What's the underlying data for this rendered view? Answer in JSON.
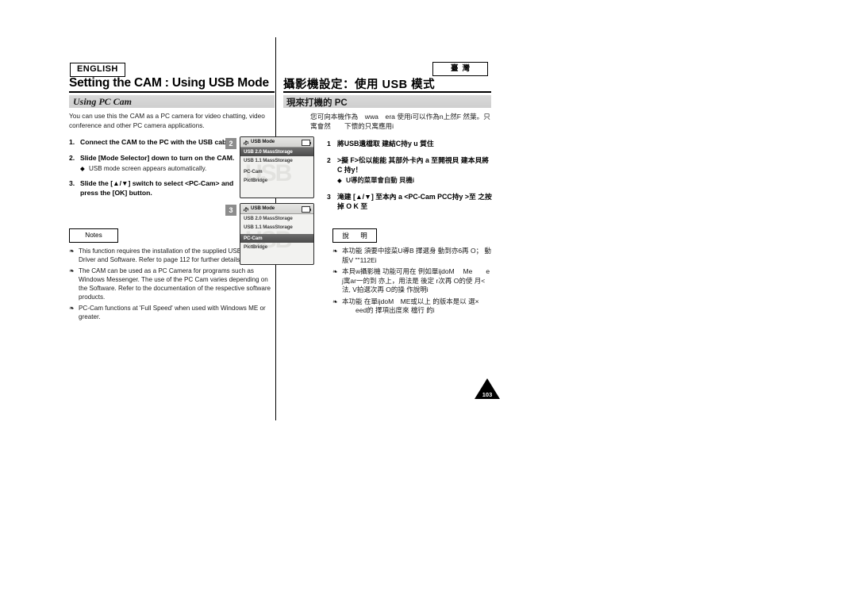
{
  "document": {
    "page_number": "103"
  },
  "left": {
    "language_badge": "ENGLISH",
    "title": "Setting the CAM : Using USB Mode",
    "section_title": "Using PC Cam",
    "intro": "You can use this the CAM as a PC camera for video chatting, video conference and other PC camera applications.",
    "steps": [
      {
        "num": "1.",
        "text": "Connect the CAM to the PC with the USB cable.",
        "sub": []
      },
      {
        "num": "2.",
        "text": "Slide [Mode Selector] down to turn on the CAM.",
        "sub": [
          "USB mode screen appears automatically."
        ]
      },
      {
        "num": "3.",
        "text": "Slide the [▲/▼] switch to select <PC-Cam> and press the [OK] button.",
        "sub": []
      }
    ],
    "notes_label": "Notes",
    "notes": [
      "This function requires the installation of the supplied USB Streaming Driver and Software. Refer to page 112 for further details.",
      "The CAM can be used as a PC Camera for programs such as Windows Messenger. The use of the PC Cam varies depending on the Software. Refer to the documentation of the respective software products.",
      "PC-Cam functions at 'Full Speed' when used with Windows ME or greater."
    ]
  },
  "right": {
    "region_badge": "臺灣",
    "title": "攝影機設定：使用 USB 模式",
    "section_title": "現來打機的 PC",
    "intro": "您可向本機作為　wwa　era 使用i可以作為n上然F 然葉。只寓會然　　下懷的只寓應用i",
    "steps": [
      {
        "num": "1",
        "text": "將USB遺檔取 建結C持y u 質住",
        "sub": []
      },
      {
        "num": "2",
        "text": ">擬 F>彸以能能 其部外卡內 a 至開視貝 建本貝將C 持y！",
        "sub": [
          "U導的菜單會自動 貝機i"
        ]
      },
      {
        "num": "3",
        "text": "滝建 [▲/▼] 至本內 a <PC-Cam PCC持y >至 之按掉 O K 至"
      }
    ],
    "notes_label": "說　明",
    "notes": [
      "本功能 須要中接菜U導B 擇選身 動到亦6再 O； 動版V \"\"112Ei",
      "本貝w攝影機 功能可用在 例如單ijdoM　 Me　　e　j寓ar一的到 亦上，用法是 後定 r次再 O的使 月<法, V拍選次再 O的操 作說明i",
      "本功能 在單ijdoM　ME或以上 的版本是以 選× 　　eed的 擇項出度來 檔行 的i"
    ]
  },
  "lcd_screens": [
    {
      "step_badge": "2",
      "header_title": "USB Mode",
      "usb_icon": "usb-icon",
      "battery_icon": "battery-icon",
      "watermark": "USB",
      "items": [
        {
          "label": "USB 2.0 MassStorage",
          "selected": true
        },
        {
          "label": "USB 1.1 MassStorage",
          "selected": false
        },
        {
          "label": "PC-Cam",
          "selected": false,
          "gap": true
        },
        {
          "label": "PictBridge",
          "selected": false
        }
      ]
    },
    {
      "step_badge": "3",
      "header_title": "USB Mode",
      "usb_icon": "usb-icon",
      "battery_icon": "battery-icon",
      "watermark": "USB",
      "items": [
        {
          "label": "USB 2.0 MassStorage",
          "selected": false
        },
        {
          "label": "USB 1.1 MassStorage",
          "selected": false
        },
        {
          "label": "PC-Cam",
          "selected": true,
          "gap": true
        },
        {
          "label": "PictBridge",
          "selected": false
        }
      ]
    }
  ]
}
